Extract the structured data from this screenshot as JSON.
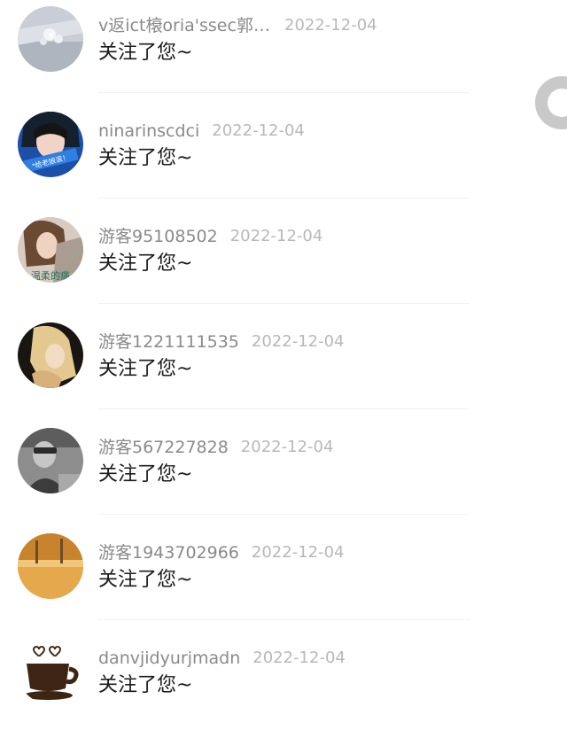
{
  "notifications": [
    {
      "username": "v返ict榱oria'ssec郭r...",
      "date": "2022-12-04",
      "message": "关注了您~",
      "avatar_icon": "silver-jewelry-avatar-icon"
    },
    {
      "username": "ninarinscdci",
      "date": "2022-12-04",
      "message": "关注了您~",
      "avatar_icon": "blue-girl-avatar-icon",
      "avatar_text": "*给老娘滚！"
    },
    {
      "username": "游客95108502",
      "date": "2022-12-04",
      "message": "关注了您~",
      "avatar_icon": "girl-portrait-avatar-icon",
      "avatar_text": "温柔的痛"
    },
    {
      "username": "游客1221111535",
      "date": "2022-12-04",
      "message": "关注了您~",
      "avatar_icon": "blonde-woman-avatar-icon"
    },
    {
      "username": "游客567227828",
      "date": "2022-12-04",
      "message": "关注了您~",
      "avatar_icon": "monochrome-man-avatar-icon"
    },
    {
      "username": "游客1943702966",
      "date": "2022-12-04",
      "message": "关注了您~",
      "avatar_icon": "autumn-leaves-avatar-icon"
    },
    {
      "username": "danvjidyurjmadn",
      "date": "2022-12-04",
      "message": "关注了您~",
      "avatar_icon": "coffee-cup-avatar-icon"
    }
  ],
  "colors": {
    "username": "#8a8a8a",
    "date": "#b8b8b8",
    "message": "#1b1b1b",
    "divider": "#f1f1f1",
    "background": "#ffffff"
  }
}
